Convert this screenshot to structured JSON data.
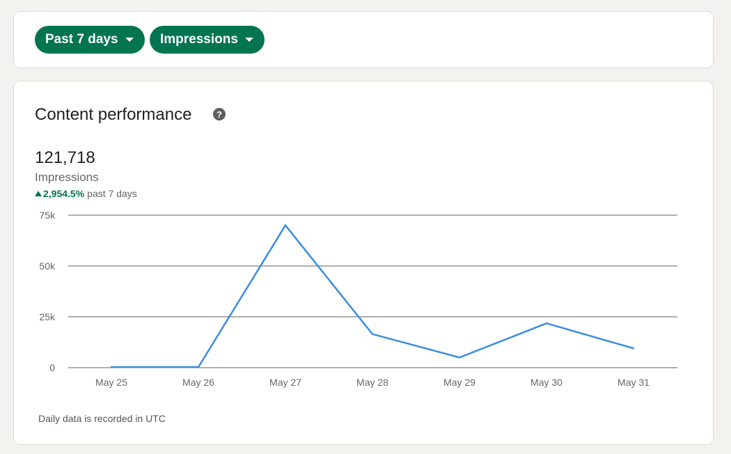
{
  "filters": {
    "range_label": "Past 7 days",
    "metric_label": "Impressions"
  },
  "performance": {
    "title": "Content performance",
    "total": "121,718",
    "metric": "Impressions",
    "change_value": "2,954.5%",
    "change_period": "past 7 days",
    "footnote": "Daily data is recorded in UTC"
  },
  "colors": {
    "accent": "#01754f",
    "line": "#3b8de0",
    "grid": "#5e5e5e"
  },
  "chart_data": {
    "type": "line",
    "categories": [
      "May 25",
      "May 26",
      "May 27",
      "May 28",
      "May 29",
      "May 30",
      "May 31"
    ],
    "values": [
      300,
      300,
      70000,
      16500,
      5000,
      21800,
      9500
    ],
    "y_ticks": [
      0,
      25000,
      50000,
      75000
    ],
    "y_tick_labels": [
      "0",
      "25k",
      "50k",
      "75k"
    ],
    "ylim": [
      0,
      75000
    ],
    "grid": true,
    "title": "",
    "xlabel": "",
    "ylabel": ""
  }
}
